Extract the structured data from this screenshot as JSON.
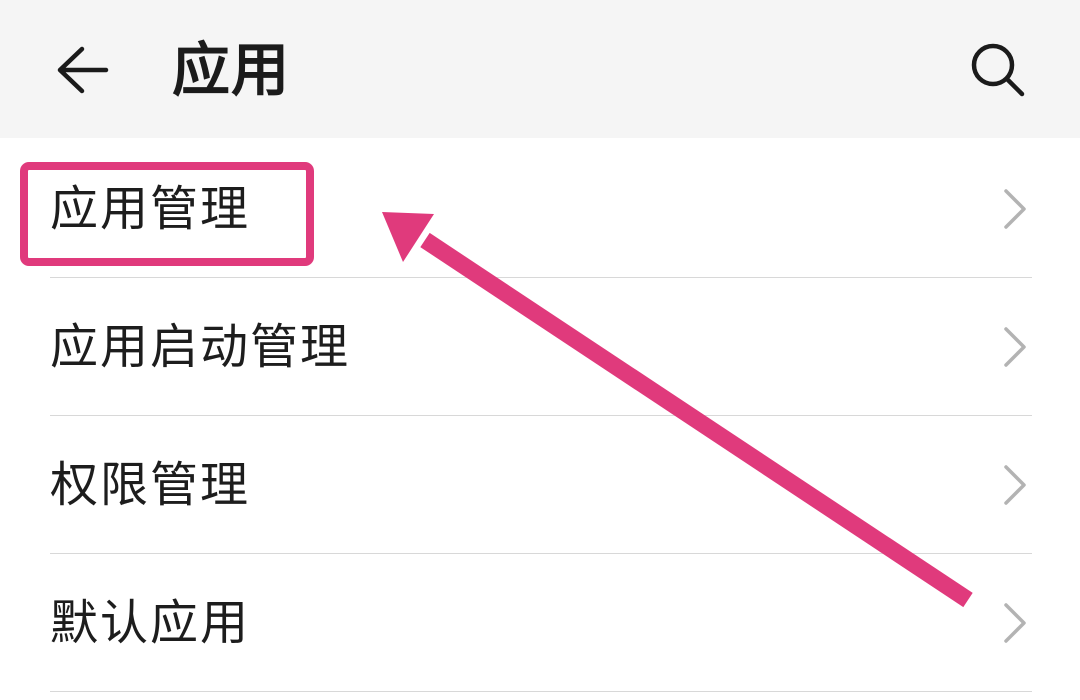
{
  "header": {
    "title": "应用",
    "back_icon": "arrow-left-icon",
    "search_icon": "search-icon"
  },
  "list": {
    "items": [
      {
        "label": "应用管理",
        "icon": "chevron-right-icon",
        "highlighted": true
      },
      {
        "label": "应用启动管理",
        "icon": "chevron-right-icon"
      },
      {
        "label": "权限管理",
        "icon": "chevron-right-icon"
      },
      {
        "label": "默认应用",
        "icon": "chevron-right-icon"
      }
    ]
  },
  "annotation": {
    "color": "#e03a7c",
    "arrow_target": "应用管理"
  },
  "colors": {
    "header_bg": "#f5f5f5",
    "divider": "#d8d8d8",
    "chevron": "#b3b3b3"
  }
}
